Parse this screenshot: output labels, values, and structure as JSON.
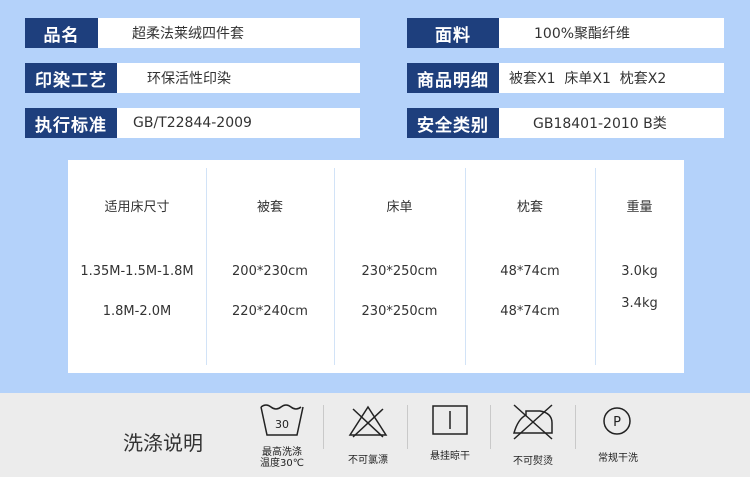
{
  "specs": {
    "name_label": "品名",
    "name_value": "超柔法莱绒四件套",
    "fabric_label": "面料",
    "fabric_value": "100%聚酯纤维",
    "print_label": "印染工艺",
    "print_value": "环保活性印染",
    "detail_label": "商品明细",
    "detail_value": "被套X1  床单X1  枕套X2",
    "standard_label": "执行标准",
    "standard_value": "GB/T22844-2009",
    "safety_label": "安全类别",
    "safety_value": "GB18401-2010 B类"
  },
  "table": {
    "headers": [
      "适用床尺寸",
      "被套",
      "床单",
      "枕套",
      "重量"
    ],
    "rows": [
      [
        "1.35M-1.5M-1.8M",
        "200*230cm",
        "230*250cm",
        "48*74cm",
        "3.0kg"
      ],
      [
        "1.8M-2.0M",
        "220*240cm",
        "230*250cm",
        "48*74cm",
        "3.4kg"
      ]
    ]
  },
  "care": {
    "title": "洗涤说明",
    "wash_temp": "30",
    "items": [
      {
        "icon": "wash-tub-icon",
        "label_line1": "最高洗涤",
        "label_line2": "温度30℃"
      },
      {
        "icon": "no-bleach-icon",
        "label_line1": "不可氯漂"
      },
      {
        "icon": "hang-dry-icon",
        "label_line1": "悬挂晾干"
      },
      {
        "icon": "no-iron-icon",
        "label_line1": "不可熨烫"
      },
      {
        "icon": "dry-clean-icon",
        "label_line1": "常规干洗"
      }
    ]
  },
  "colors": {
    "page_bg": "#b4d2fa",
    "label_bg": "#1e3f7d",
    "care_bg": "#ececec"
  }
}
